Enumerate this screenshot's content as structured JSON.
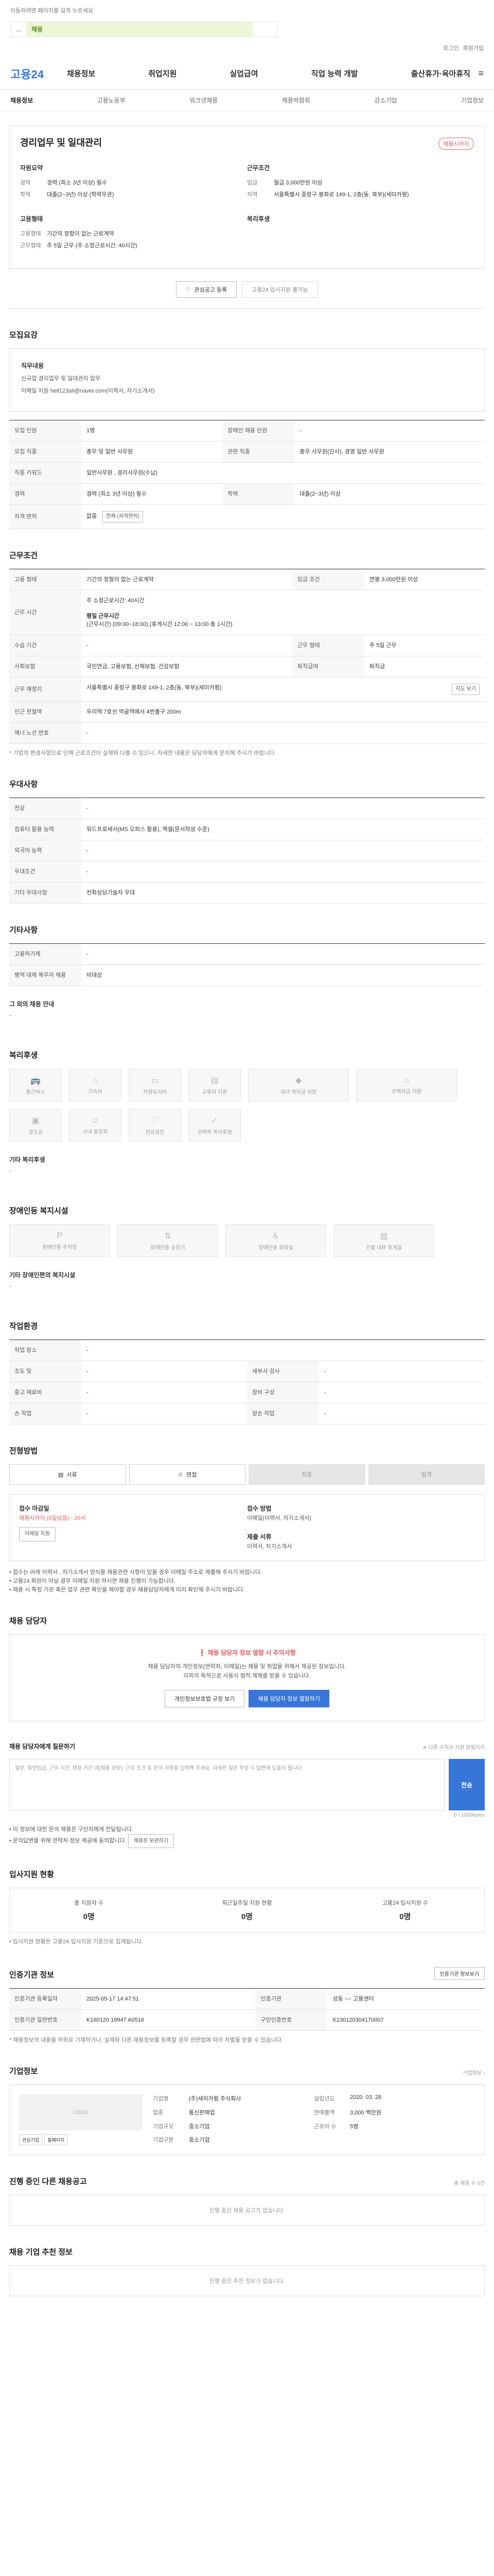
{
  "browser": {
    "notice": "이동하려면 페이지를 길게 누르세요",
    "tab_label": "채용",
    "tab_other": "...",
    "top_links": [
      "로그인",
      "회원가입"
    ]
  },
  "gnb": {
    "logo_a": "고용",
    "logo_b": "24",
    "menu": [
      "채용정보",
      "취업지원",
      "실업급여",
      "직업 능력 개발",
      "출산휴가·육아휴직"
    ]
  },
  "lnb": [
    "채용정보",
    "고용노동부",
    "워크넷채용",
    "채용박람회",
    "강소기업",
    "기업정보"
  ],
  "title": {
    "heading": "경리업무 및 일대관리",
    "badge": "채용시까지",
    "left_title": "자원요약",
    "right_title": "근무조건",
    "left": [
      {
        "k": "경력",
        "v": "경력 (최소 3년 이상) 필수"
      },
      {
        "k": "학력",
        "v": "대졸(2~3년) 이상 (학력무관)"
      }
    ],
    "right": [
      {
        "k": "임금",
        "v": "월급 3,000만원 이상"
      },
      {
        "k": "지역",
        "v": "서울특별시 중랑구 봉화로 149-1, 2층(동, 북부)(세미카펌)"
      }
    ],
    "left2_title": "고용형태",
    "left2": [
      {
        "k": "고용형태",
        "v": "기간의 정함이 없는 근로계약"
      },
      {
        "k": "근무형태",
        "v": "주 5일 근무 (주 소정근로시간: 40시간)"
      }
    ],
    "right2_title": "복리후생",
    "btn_interest": "관심공고 등록",
    "btn_apply": "고용24 입사지원 불가능"
  },
  "recruit": {
    "heading": "모집요강",
    "job_title": "직무내용",
    "job_desc": "신규업 경리업무 및 일대관리 업무",
    "contact_text": "이메일 지원 hell123ail@naver.com(이력서, 자기소개서)",
    "rows": [
      [
        "모집 인원",
        "1명",
        "장애인 채용 인원",
        "-"
      ],
      [
        "모집 직종",
        "총무 및 일반 사무원",
        "관련 직종",
        "총무 사무원(인사), 경영 일반 사무원"
      ],
      [
        "직종 키워드",
        "일반사무원 , 경리사무원(수납)",
        "",
        ""
      ],
      [
        "경력",
        "경력 (최소 3년 이상) 필수",
        "학력",
        "대졸(2~3년) 이상"
      ],
      [
        "자격 면허",
        "없음",
        "",
        ""
      ]
    ],
    "license_btn": "전체 (자격면허)"
  },
  "work": {
    "heading": "근무조건",
    "rows": [
      [
        "고용 형태",
        "기간의 정함이 없는 근로계약",
        "임금 조건",
        "연봉 3,000만원 이상"
      ],
      [
        "근무 시간",
        "주 소정근로시간: 40시간",
        "",
        ""
      ],
      [
        "수습 기간",
        "-",
        "근무 형태",
        "주 5일 근무"
      ],
      [
        "사회보험",
        "국민연금, 고용보험, 산재보험, 건강보험",
        "퇴직급여",
        "퇴직금"
      ],
      [
        "근무 예정지",
        "서울특별시 중랑구 봉화로 149-1, 2층(동, 북부)(세미카펌)",
        "",
        ""
      ],
      [
        "인근 전철역",
        "우리역 7호선 먹골역에서 4번출구 200m",
        "",
        ""
      ],
      [
        "에너 노선 번호",
        "-",
        "",
        ""
      ]
    ],
    "time_sub": "평일 근무시간",
    "time_detail": "(근무시간) (09:00~18:00) (휴게시간 12:00 ~ 13:00 총 1시간)",
    "map_btn": "지도 보기",
    "note": "* 기업의 변경사항으로 인해 근로조건이 실제와 다를 수 있으니, 자세한 내용은 담당자에게 문의해 주시기 바랍니다."
  },
  "pref": {
    "heading": "우대사항",
    "rows": [
      [
        "전공",
        "-"
      ],
      [
        "컴퓨터 활용 능력",
        "워드프로세서(MS 오피스 활용), 엑셀(문서작성 수준)"
      ],
      [
        "외국어 능력",
        "-"
      ],
      [
        "우대조건",
        "-"
      ],
      [
        "기타 우대사항",
        "전화상담기술자 우대"
      ]
    ]
  },
  "etc": {
    "heading": "기타사항",
    "rows": [
      [
        "고용허가제",
        "-"
      ],
      [
        "병역 대체 복무자 채용",
        "비대상"
      ]
    ],
    "sub": "그 외의 채용 안내",
    "sub_val": "-"
  },
  "welfare": {
    "heading": "복리후생",
    "items": [
      "통근버스",
      "기숙사",
      "차량유지비",
      "교육비 지원",
      "자녀 학자금 지원",
      "주택자금 지원",
      "경조금",
      "사내 동호회",
      "건강검진",
      "선택적 복리후생"
    ],
    "other_title": "기타 복리후생",
    "other_val": "-"
  },
  "disabled": {
    "heading": "장애인등 복지시설",
    "items": [
      "장애인용 주차장",
      "장애인용 승강기",
      "장애인용 화장실",
      "건물 내부 휴게실"
    ],
    "other_title": "기타 장애인편의 복지시설",
    "other_val": "-"
  },
  "environ": {
    "heading": "작업환경",
    "rows": [
      [
        "작업 장소",
        "-",
        "",
        ""
      ],
      [
        "조도 및",
        "-",
        "세부사 검사",
        "-"
      ],
      [
        "중고 재료비",
        "-",
        "장비 구성",
        "-"
      ],
      [
        "손 작업",
        "-",
        "양손 작업",
        "-"
      ]
    ]
  },
  "process": {
    "heading": "전형방법",
    "steps": [
      "서류",
      "면접",
      "최종",
      "합격"
    ],
    "deadline_label": "접수 마감일",
    "deadline_val": "채용시까지 (0일남음) - 26시",
    "method_label": "접수 방법",
    "method_val": "이메일(이력서, 자기소개서)",
    "docs_label": "제출 서류",
    "docs_val": "이력서, 자기소개서",
    "apply_btn": "이메일 지원",
    "bullets": [
      "• 접수는 아래 이력서 , 자기소개서 양식을 채용관련 사항이 있을 경우 이메일 주소로 제출해 주시기 바랍니다.",
      "• 고용24 회원이 아닐 경우 이메일 지원 하시면 채용 진행이 가능합니다.",
      "• 채용 시 특정 기관 혹은 업무 관련 확인을 해야할 경우 채용담당자에게 미리 확인해 주시기 바랍니다."
    ]
  },
  "contact": {
    "heading": "채용 담당자",
    "alert": "채용 담당자 정보 열람 시 주의사항",
    "line1": "채용 담당자의 개인정보(연락처, 이메일)는 채용 및 취업을 위해서 제공된 정보입니다.",
    "line2": "이외의 목적으로 사용시 법적 제재를 받을 수 있습니다.",
    "btn1": "개인정보보호법 규정 보기",
    "btn2": "채용 담당자 정보 열람하기"
  },
  "inquiry": {
    "heading": "채용 담당자에게 질문하기",
    "right_note": "※ 다른 구직자 지원 알림지키",
    "placeholder": "질문, 희망임금, 근무 시간, 채용 기간 내(채용 상담), 근무 조건 등 문의 사항을 입력해 주세요. 자세한 질문 작성 시 답변에 도움이 됩니다.",
    "counter": "0 / 1000bytes",
    "send": "전송",
    "bullets": [
      "• 이 정보에 대한 문의 채용은 구인자에게 전달됩니다.",
      "• 문의답변을 위해 연락처 정보 제공에 동의합니다."
    ],
    "btn": "채용문 보관하기"
  },
  "stats": {
    "heading": "입사지원 현황",
    "items": [
      {
        "label": "총 지원자 수",
        "val": "0명"
      },
      {
        "label": "최근일주일 지원 현황",
        "val": "0명"
      },
      {
        "label": "고용24 입사지원 수",
        "val": "0명"
      }
    ],
    "note": "• 입사지원 현황은 고용24 입사지원 기준으로 집계됩니다."
  },
  "info": {
    "heading": "인증기관 정보",
    "btn": "인증기관 정보보기",
    "rows": [
      [
        "인증기관 등록일자",
        "2025-05-17 14:47:51",
        "인증기관",
        "성동 ○○ 고용센터"
      ],
      [
        "인증기관 일련번호",
        "K160120 19947 A0516",
        "구인인증번호",
        "K130120304170007"
      ]
    ],
    "note": "* 채용정보의 내용을 허위로 기재하거나, 실제와 다른 채용정보를 등록할 경우 관련법에 따라 처벌을 받을 수 있습니다."
  },
  "company": {
    "heading": "기업정보",
    "link": "기업정보 ›",
    "logo": "LOGO",
    "btns": [
      "관심기업",
      "홈페이지"
    ],
    "rows": [
      [
        "기업명",
        "(주)세미카펌 주식회사",
        "설립년도",
        "2020. 03. 28"
      ],
      [
        "업종",
        "통신판매업",
        "연매출액",
        "3,000 백만원"
      ],
      [
        "기업규모",
        "중소기업",
        "근로자 수",
        "5명"
      ],
      [
        "기업구분",
        "중소기업",
        "",
        ""
      ]
    ]
  },
  "other_jobs": {
    "heading": "진행 중인 다른 채용공고",
    "right": "총 채용 수 0건",
    "empty": "진행 중인 채용 공고가 없습니다."
  },
  "recent": {
    "heading": "채용 기업 추천 정보",
    "empty": "진행 중인 추천 정보가 없습니다."
  }
}
